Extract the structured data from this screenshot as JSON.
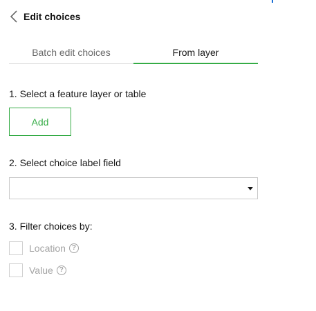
{
  "header": {
    "back_icon": "chevron-left-icon",
    "title": "Edit choices"
  },
  "tabs": [
    {
      "label": "Batch edit choices",
      "active": false
    },
    {
      "label": "From layer",
      "active": true
    }
  ],
  "step1": {
    "label": "1. Select a feature layer or table",
    "add_label": "Add"
  },
  "step2": {
    "label": "2. Select choice label field",
    "selected_value": ""
  },
  "step3": {
    "label": "3. Filter choices by:",
    "options": [
      {
        "label": "Location",
        "checked": false,
        "icon": "help-icon"
      },
      {
        "label": "Value",
        "checked": false,
        "icon": "help-icon"
      }
    ]
  },
  "colors": {
    "accent": "#35ac46",
    "text": "#151515",
    "muted": "#6a6a6a",
    "disabled": "#a3a3a3",
    "border": "#cacaca"
  }
}
